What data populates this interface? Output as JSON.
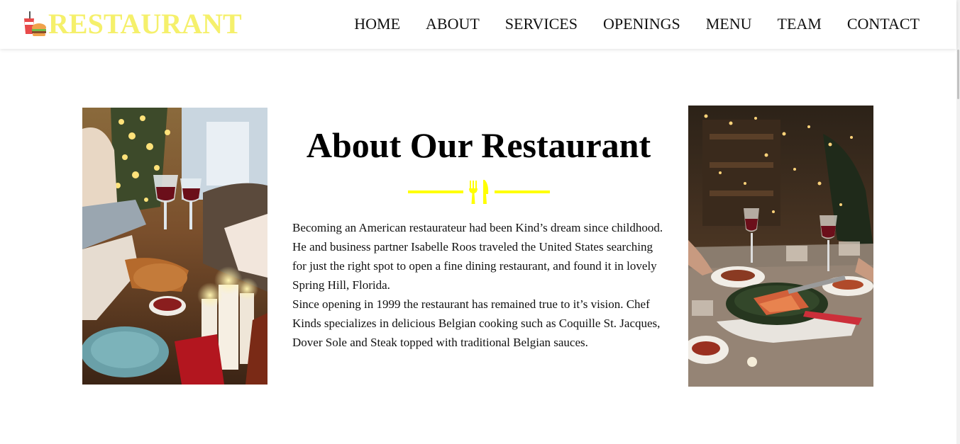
{
  "header": {
    "brand": "RESTAURANT",
    "brand_color": "#f5f06b",
    "logo_icon": "fast-food-icon",
    "nav": [
      "HOME",
      "ABOUT",
      "SERVICES",
      "OPENINGS",
      "MENU",
      "TEAM",
      "CONTACT"
    ]
  },
  "about": {
    "title": "About Our Restaurant",
    "divider_icon": "fork-knife-icon",
    "accent_color": "#ffff00",
    "paragraph1": "Becoming an American restaurateur had been Kind’s dream since childhood. He and business partner Isabelle Roos traveled the United States searching for just the right spot to open a fine dining restaurant, and found it in lovely Spring Hill, Florida.",
    "paragraph2": "Since opening in 1999 the restaurant has remained true to it’s vision. Chef Kinds specializes in delicious Belgian cooking such as Coquille St. Jacques, Dover Sole and Steak topped with traditional Belgian sauces."
  }
}
